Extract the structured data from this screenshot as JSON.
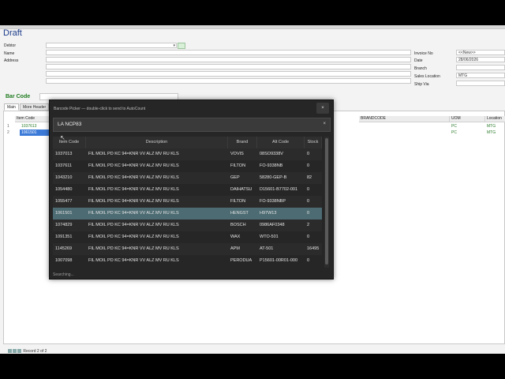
{
  "window": {
    "title": "Draft"
  },
  "form": {
    "debtor_label": "Debtor",
    "name_label": "Name",
    "address_label": "Address",
    "invoice_no_label": "Invoice No",
    "invoice_no_value": "<<New>>",
    "date_label": "Date",
    "date_value": "28/06/2026",
    "branch_label": "Branch",
    "sales_location_label": "Sales Location",
    "sales_location_value": "MTG",
    "ship_via_label": "Ship Via",
    "barcode_label": "Bar Code"
  },
  "tabs": [
    {
      "label": "Main"
    },
    {
      "label": "More Header"
    }
  ],
  "grid": {
    "headers": {
      "item_code": "Item Code",
      "brandcode": "BRANDCODE",
      "uom": "UOM",
      "location": "Location"
    },
    "rows": [
      {
        "num": "1",
        "item_code": "1037613",
        "uom": "PC",
        "location": "MTG"
      },
      {
        "num": "2",
        "item_code": "1061501",
        "uom": "PC",
        "location": "MTG"
      }
    ]
  },
  "footer": {
    "record": "Record 2 of 2"
  },
  "dialog": {
    "title": "Barcode Picker — double-click to send to AutoCount",
    "close": "×",
    "search_value": "LA NCP83",
    "search_clear": "×",
    "columns": [
      "Item Code",
      "Description",
      "Brand",
      "Alt Code",
      "Stock"
    ],
    "rows": [
      {
        "code": "1037013",
        "desc": "FIL MOIL PD KC 94=KNR VV ALZ MV RU KLS",
        "brand": "VOVIS",
        "alt": "08SO9338V",
        "stock": "0"
      },
      {
        "code": "1037611",
        "desc": "FIL MOIL PD KC 94=KNR VV ALZ MV RU KLS",
        "brand": "FILTON",
        "alt": "FO-9338NB",
        "stock": "0"
      },
      {
        "code": "1043210",
        "desc": "FIL MOIL PD KC 94=KNR VV ALZ MV RU KLS",
        "brand": "GEP",
        "alt": "58280-GEP-B",
        "stock": "82"
      },
      {
        "code": "1054480",
        "desc": "FIL MOIL PD KC 94=KNR VV ALZ MV RU KLS",
        "brand": "DAIHATSU",
        "alt": "D15601-B7702-001",
        "stock": "0"
      },
      {
        "code": "1055477",
        "desc": "FIL MOIL PD KC 94=KNR VV ALZ MV RU KLS",
        "brand": "FILTON",
        "alt": "FO-9338NBP",
        "stock": "0"
      },
      {
        "code": "1061501",
        "desc": "FIL MOIL PD KC 94=KNR VV ALZ MV RU KLS",
        "brand": "HENGST",
        "alt": "H97W13",
        "stock": "0",
        "selected": true
      },
      {
        "code": "1074829",
        "desc": "FIL MOIL PD KC 94=KNR VV ALZ MV RU KLS",
        "brand": "BOSCH",
        "alt": "0986AF0348",
        "stock": "2"
      },
      {
        "code": "1091351",
        "desc": "FIL MOIL PD KC 94=KNR VV ALZ MV RU KLS",
        "brand": "WAX",
        "alt": "WTO-501",
        "stock": "0"
      },
      {
        "code": "1145269",
        "desc": "FIL MOIL PD KC 94=KNR VV ALZ MV RU KLS",
        "brand": "APM",
        "alt": "AT-501",
        "stock": "16495"
      },
      {
        "code": "1007098",
        "desc": "FIL MOIL PD KC 94=KNR VV ALZ MV RU KLS",
        "brand": "PERODUA",
        "alt": "P15601-00R01-000",
        "stock": "0"
      }
    ],
    "status": "Searching..."
  },
  "colors": {
    "barcode_green": "#1e7a1e",
    "selection": "#4c6b72",
    "dialog_bg": "#262626"
  }
}
